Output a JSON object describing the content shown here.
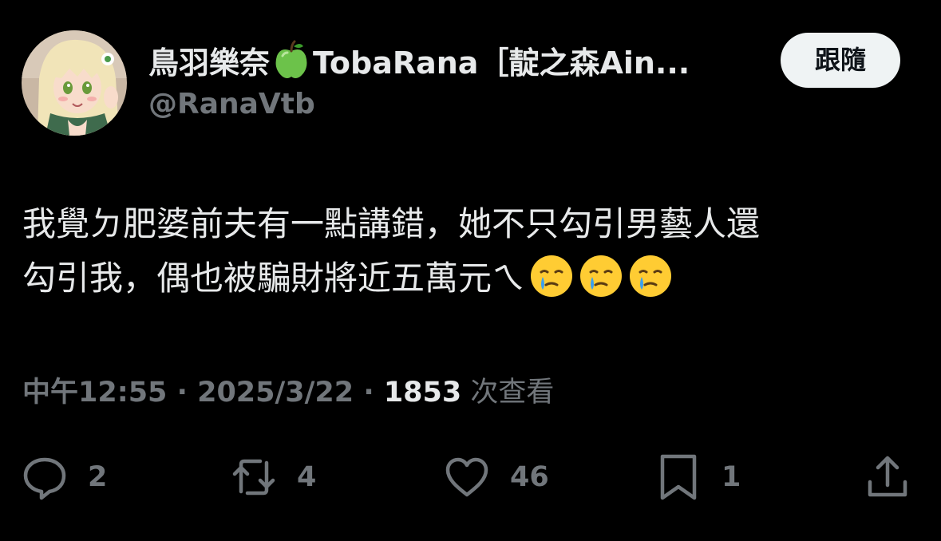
{
  "author": {
    "name_prefix": "鳥羽樂奈",
    "name_suffix": "TobaRana［靛之森Ain...",
    "name_emoji": "green-apple-emoji",
    "handle": "@RanaVtb",
    "avatar_icon": "anime-avatar"
  },
  "follow_button": {
    "label": "跟隨"
  },
  "tweet": {
    "line1": "我覺ㄉ肥婆前夫有一點講錯，她不只勾引男藝人還",
    "line2": "勾引我，偶也被騙財將近五萬元ㄟ",
    "emoji": "face-holding-back-tears-emoji"
  },
  "meta": {
    "time": "中午12:55",
    "separator": " · ",
    "date": "2025/3/22",
    "views_count": "1853",
    "views_label": " 次查看"
  },
  "actions": {
    "reply": "2",
    "retweet": "4",
    "like": "46",
    "bookmark": "1"
  },
  "colors": {
    "background": "#000000",
    "primary_text": "#e7e9ea",
    "secondary_text": "#71767b",
    "follow_button_bg": "#eff3f4",
    "follow_button_text": "#0f1419"
  }
}
